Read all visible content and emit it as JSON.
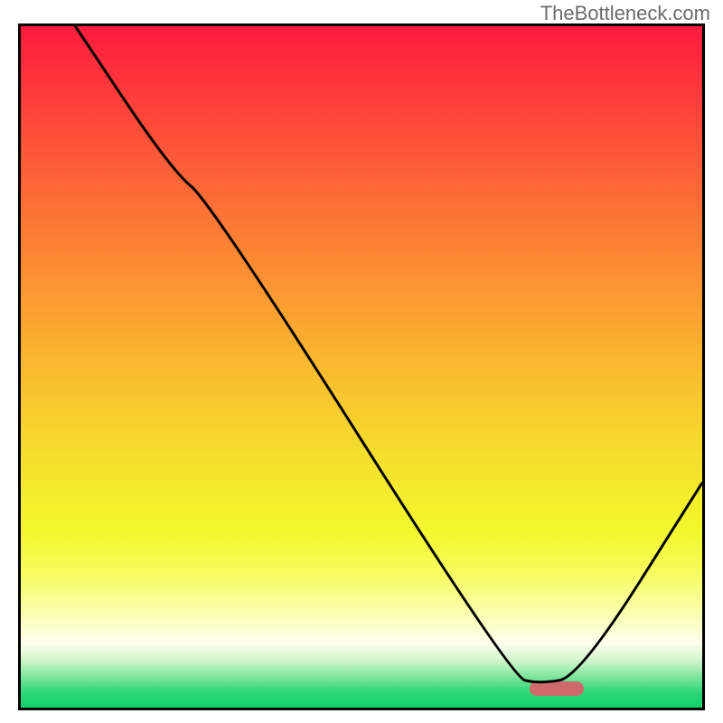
{
  "watermark": "TheBottleneck.com",
  "colors": {
    "frame": "#000000",
    "curve": "#000000",
    "marker": "#cf6a6c",
    "gradient_stops": [
      {
        "offset": 0.0,
        "color": "#fd1b3e"
      },
      {
        "offset": 0.1,
        "color": "#fe3b3b"
      },
      {
        "offset": 0.22,
        "color": "#fd6237"
      },
      {
        "offset": 0.35,
        "color": "#fc8b33"
      },
      {
        "offset": 0.48,
        "color": "#fab42f"
      },
      {
        "offset": 0.62,
        "color": "#f5dc2c"
      },
      {
        "offset": 0.74,
        "color": "#f3f72c"
      },
      {
        "offset": 0.8,
        "color": "#f6fc5c"
      },
      {
        "offset": 0.86,
        "color": "#fafeac"
      },
      {
        "offset": 0.905,
        "color": "#fefeee"
      },
      {
        "offset": 0.93,
        "color": "#d2f6cd"
      },
      {
        "offset": 0.955,
        "color": "#7ee59d"
      },
      {
        "offset": 0.975,
        "color": "#35d878"
      },
      {
        "offset": 1.0,
        "color": "#0fd168"
      }
    ]
  },
  "chart_data": {
    "type": "line",
    "title": "",
    "xlabel": "",
    "ylabel": "",
    "xlim": [
      0,
      100
    ],
    "ylim": [
      0,
      100
    ],
    "grid": false,
    "series": [
      {
        "name": "bottleneck-curve",
        "x": [
          8,
          22,
          28,
          72,
          76,
          82,
          100
        ],
        "y": [
          100,
          79,
          74,
          4.5,
          3.5,
          4.5,
          33
        ]
      }
    ],
    "annotations": [
      {
        "name": "optimal-marker",
        "x": 78,
        "y": 3.5,
        "shape": "pill",
        "color": "#cf6a6c"
      }
    ]
  }
}
